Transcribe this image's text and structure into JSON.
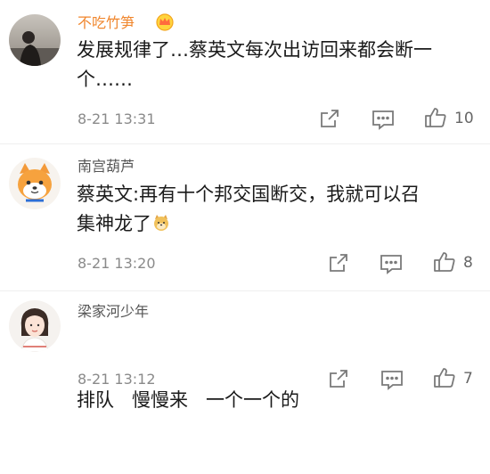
{
  "comments": [
    {
      "username": "不吃竹笋",
      "username_color": "#f0862d",
      "content_line1": "发展规律了…蔡英文每次出访回来都会断一",
      "content_line2": "个……",
      "timestamp": "8-21 13:31",
      "likes": "10",
      "has_vip_badge": true
    },
    {
      "username": "南宫葫芦",
      "username_color": "#555555",
      "content_line1": "蔡英文:再有十个邦交国断交，我就可以召",
      "content_line2": "集神龙了",
      "emoji": "doge-emoji",
      "timestamp": "8-21 13:20",
      "likes": "8"
    },
    {
      "username": "梁家河少年",
      "username_color": "#555555",
      "content_line1": "排队   慢慢来   一个一个的",
      "timestamp": "8-21 13:12",
      "likes": "7"
    }
  ],
  "icons": {
    "share": "share-icon",
    "comment": "comment-icon",
    "like": "thumbs-up-icon"
  }
}
